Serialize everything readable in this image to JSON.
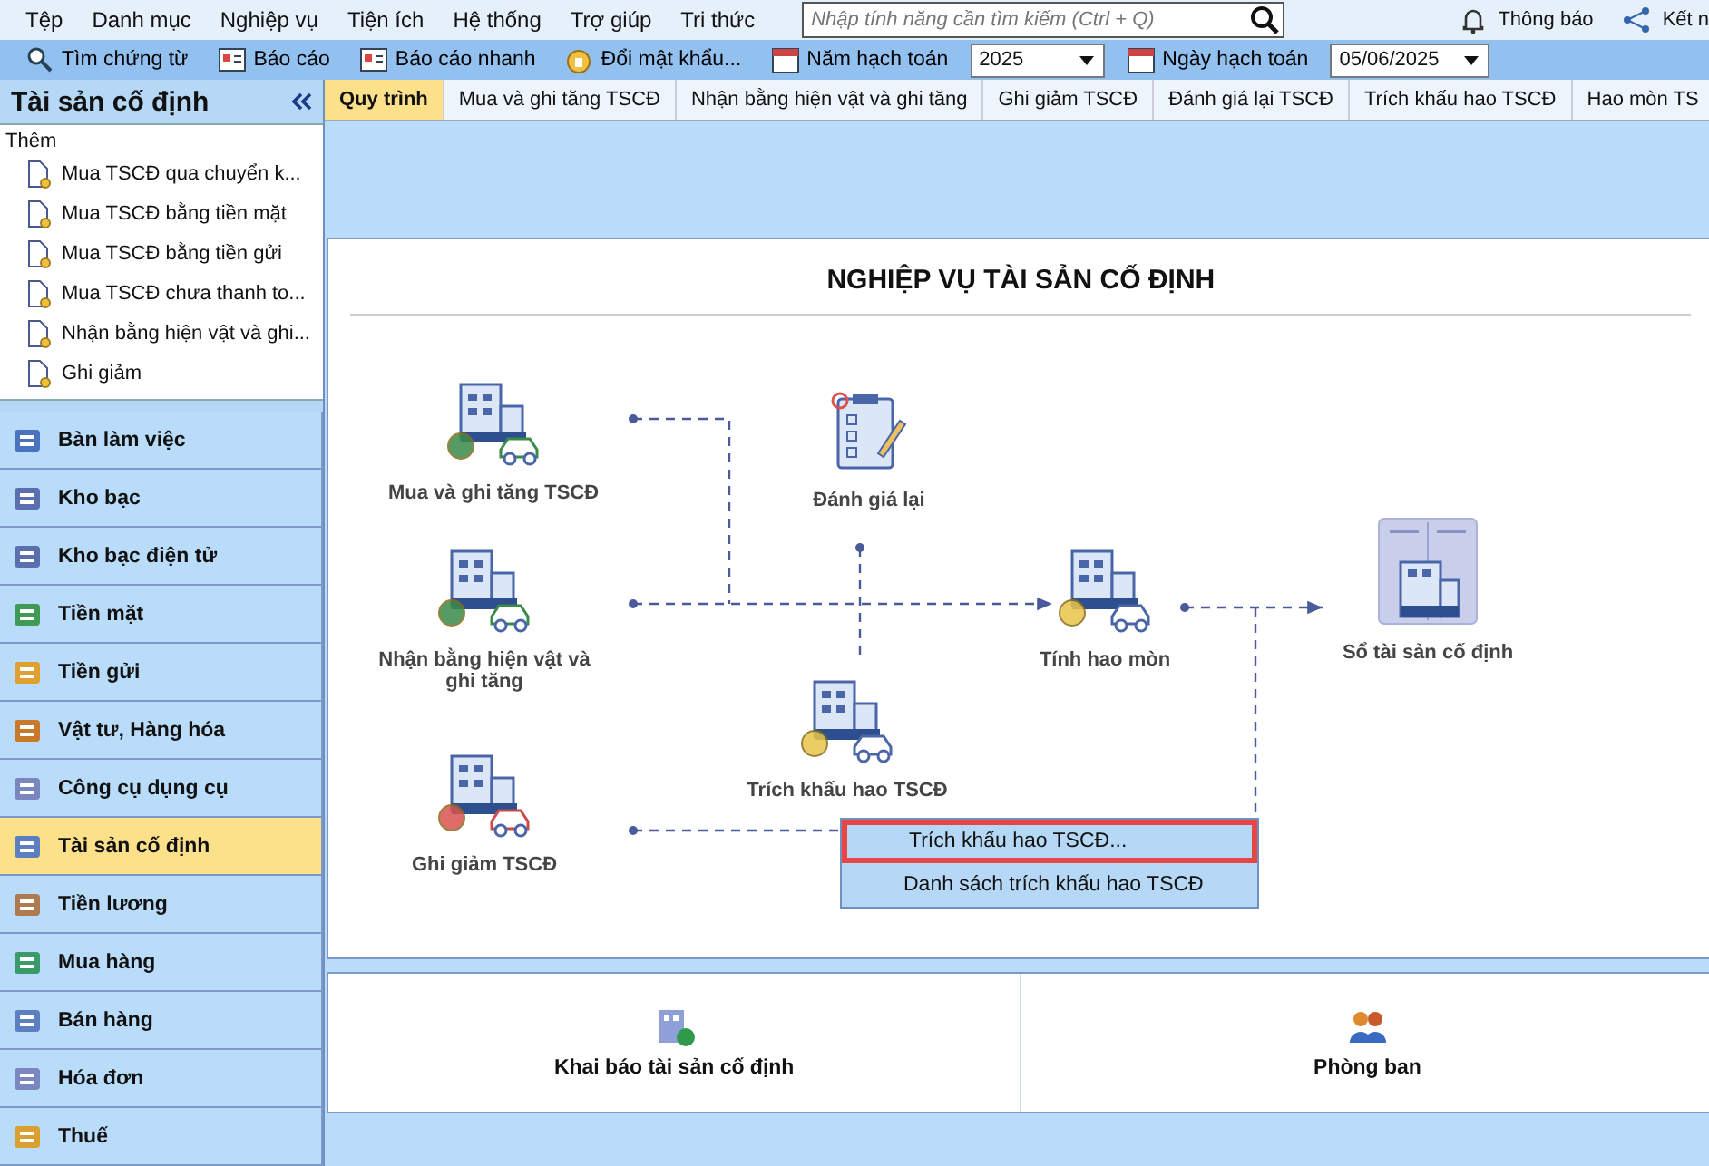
{
  "menu": [
    "Tệp",
    "Danh mục",
    "Nghiệp vụ",
    "Tiện ích",
    "Hệ thống",
    "Trợ giúp",
    "Tri thức"
  ],
  "search": {
    "placeholder": "Nhập tính năng cần tìm kiếm (Ctrl + Q)"
  },
  "notifications": "Thông báo",
  "connect": "Kết n",
  "toolbar": [
    "Tìm chứng từ",
    "Báo cáo",
    "Báo cáo nhanh",
    "Đổi mật khẩu..."
  ],
  "year": {
    "label": "Năm hạch toán",
    "value": "2025"
  },
  "date": {
    "label": "Ngày hạch toán",
    "value": "05/06/2025"
  },
  "sidebar": {
    "title": "Tài sản cố định",
    "section": "Thêm",
    "items": [
      "Mua TSCĐ qua chuyển k...",
      "Mua TSCĐ bằng tiền mặt",
      "Mua TSCĐ bằng tiền gửi",
      "Mua TSCĐ chưa thanh to...",
      "Nhận bằng hiện vật và ghi...",
      "Ghi giảm"
    ],
    "nav": [
      {
        "label": "Bàn làm việc",
        "selected": false
      },
      {
        "label": "Kho bạc",
        "selected": false
      },
      {
        "label": "Kho bạc điện tử",
        "selected": false
      },
      {
        "label": "Tiền mặt",
        "selected": false
      },
      {
        "label": "Tiền gửi",
        "selected": false
      },
      {
        "label": "Vật tư, Hàng hóa",
        "selected": false
      },
      {
        "label": "Công cụ dụng cụ",
        "selected": false
      },
      {
        "label": "Tài sản cố định",
        "selected": true
      },
      {
        "label": "Tiền lương",
        "selected": false
      },
      {
        "label": "Mua hàng",
        "selected": false
      },
      {
        "label": "Bán hàng",
        "selected": false
      },
      {
        "label": "Hóa đơn",
        "selected": false
      },
      {
        "label": "Thuế",
        "selected": false
      }
    ]
  },
  "tabs": [
    {
      "label": "Quy trình",
      "selected": true
    },
    {
      "label": "Mua và ghi tăng TSCĐ",
      "selected": false
    },
    {
      "label": "Nhận bằng hiện vật và ghi tăng",
      "selected": false
    },
    {
      "label": "Ghi giảm TSCĐ",
      "selected": false
    },
    {
      "label": "Đánh giá lại TSCĐ",
      "selected": false
    },
    {
      "label": "Trích khấu hao TSCĐ",
      "selected": false
    },
    {
      "label": "Hao mòn TS",
      "selected": false
    }
  ],
  "diagram": {
    "title": "NGHIỆP VỤ TÀI SẢN CỐ ĐỊNH",
    "nodes": [
      {
        "label": "Mua và ghi tăng TSCĐ"
      },
      {
        "label": "Nhận bằng hiện vật và ghi tăng"
      },
      {
        "label": "Ghi giảm TSCĐ"
      },
      {
        "label": "Đánh giá lại"
      },
      {
        "label": "Trích khấu hao TSCĐ"
      },
      {
        "label": "Tính hao mòn"
      },
      {
        "label": "Sổ tài sản cố định"
      }
    ],
    "context_menu": [
      {
        "label": "Trích khấu hao TSCĐ...",
        "selected": true
      },
      {
        "label": "Danh sách trích khấu hao TSCĐ",
        "selected": false
      }
    ]
  },
  "shortcuts": [
    "Khai báo tài sản cố định",
    "Phòng ban"
  ]
}
